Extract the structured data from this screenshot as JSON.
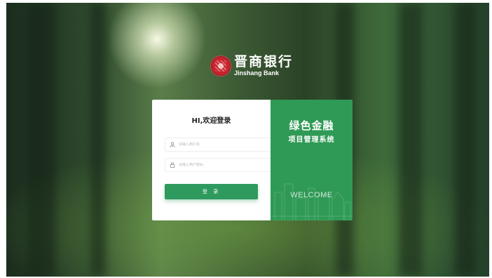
{
  "brand": {
    "name_cn": "晋商银行",
    "name_en": "Jinshang Bank",
    "logo_icon": "jinshang-bank-logo-icon"
  },
  "login": {
    "greeting": "HI,欢迎登录",
    "username_placeholder": "请输入用户名",
    "password_placeholder": "请输入用户密码",
    "username_icon": "user-icon",
    "password_icon": "lock-icon",
    "submit_label": "登 录"
  },
  "side_panel": {
    "title": "绿色金融",
    "subtitle": "项目管理系统",
    "welcome": "WELCOME"
  },
  "colors": {
    "accent": "#2f9a55",
    "button": "#2e9a5e"
  }
}
